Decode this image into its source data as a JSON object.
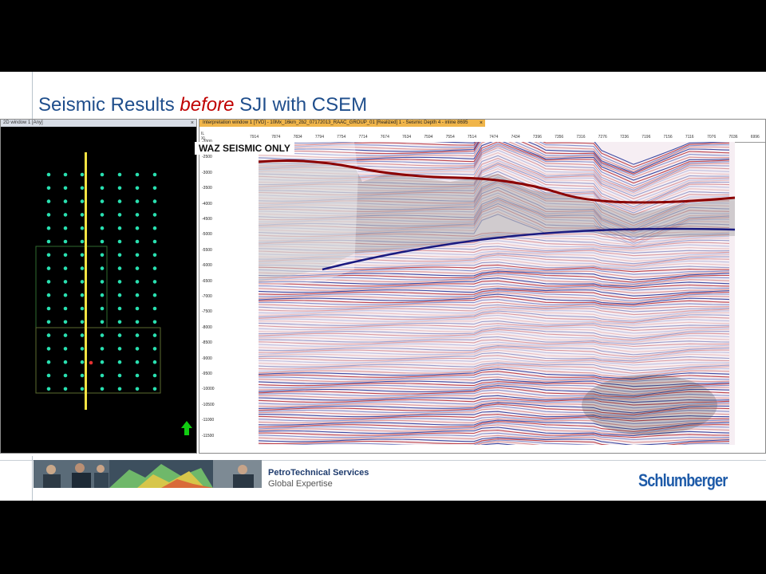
{
  "slide": {
    "title_part1": "Seismic Results ",
    "title_emph": "before",
    "title_part2": " SJI with CSEM"
  },
  "window_2d": {
    "title": "2D window 1 [Any]",
    "close": "×",
    "north_arrow_color": "#11cc11",
    "line_color": "#f5e342",
    "dot_color": "#29e0b0"
  },
  "interpretation_window": {
    "title": "Interpretation window 1 [TVD] - 10Mx_16km_2b2_07172013_RAAC_GROUP_01 [Realized] 1 - Seismic Depth 4 - inline 8695",
    "close": "×",
    "header_rows": [
      "IL",
      "XL"
    ],
    "xl_values": [
      "7914",
      "7874",
      "7834",
      "7794",
      "7754",
      "7714",
      "7674",
      "7634",
      "7594",
      "7554",
      "7514",
      "7474",
      "7434",
      "7396",
      "7356",
      "7316",
      "7276",
      "7236",
      "7196",
      "7156",
      "7116",
      "7076",
      "7036",
      "6996",
      "6956"
    ],
    "depth_ticks": [
      "-2000",
      "-2500",
      "-3000",
      "-3500",
      "-4000",
      "-4500",
      "-5000",
      "-5500",
      "-6000",
      "-6500",
      "-7000",
      "-7500",
      "-8000",
      "-8500",
      "-9000",
      "-9500",
      "-10000",
      "-10500",
      "-11000",
      "-11500"
    ],
    "annotation": "WAZ SEISMIC ONLY"
  },
  "footer": {
    "company_line1": "PetroTechnical Services",
    "company_line2": "Global Expertise",
    "logo": "Schlumberger"
  }
}
